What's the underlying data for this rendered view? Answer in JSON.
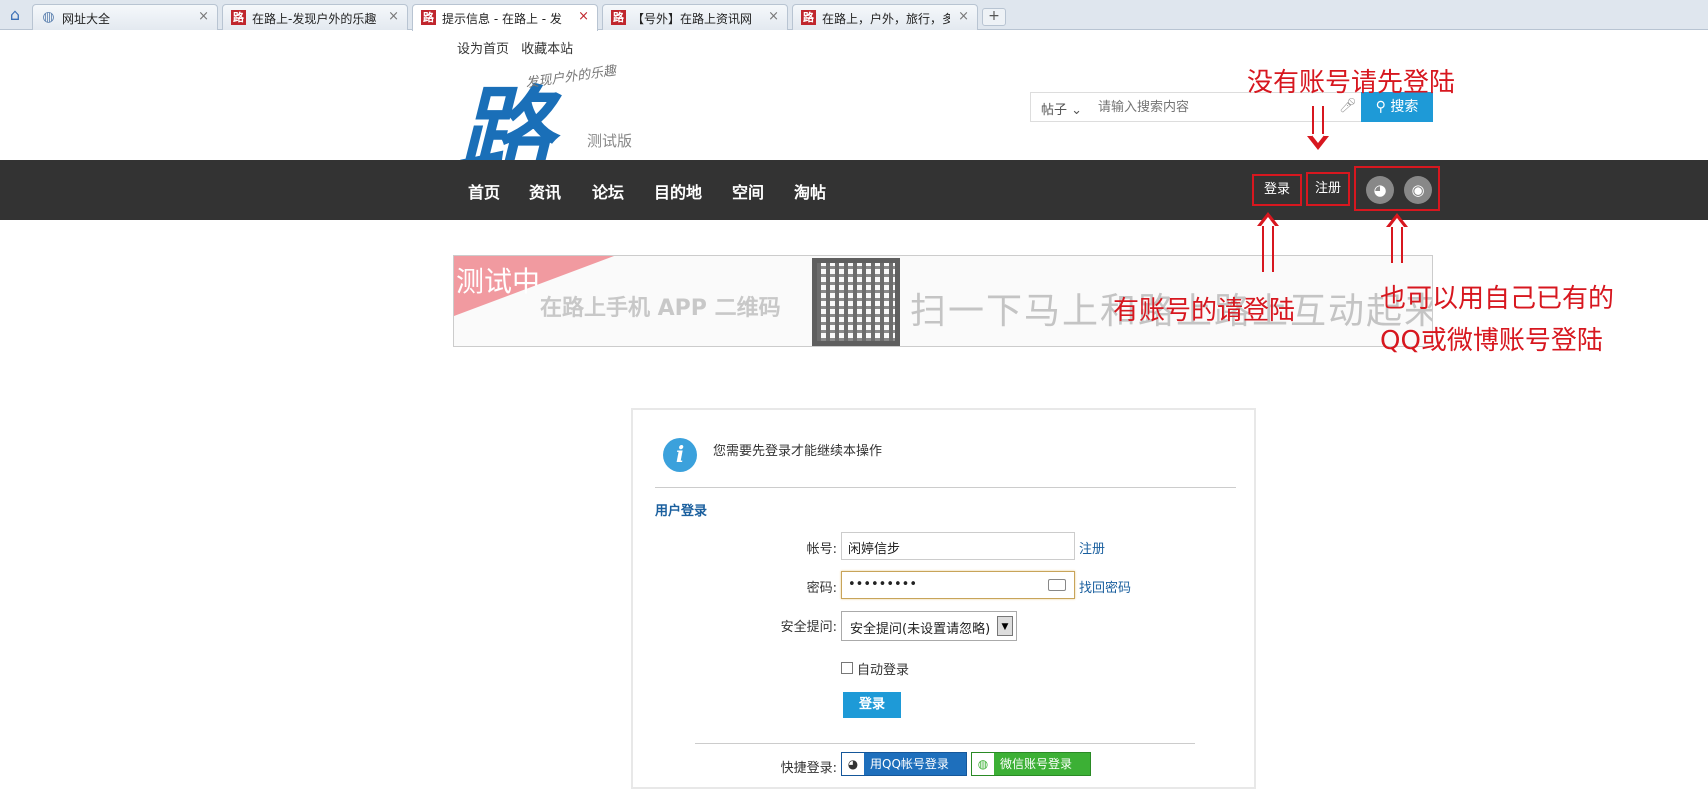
{
  "browser": {
    "tabs": [
      {
        "favicon": "globe-icon",
        "title": "网址大全",
        "active": false
      },
      {
        "favicon": "路",
        "title": "在路上-发现户外的乐趣",
        "active": false
      },
      {
        "favicon": "路",
        "title": "提示信息 - 在路上 - 发",
        "active": true
      },
      {
        "favicon": "路",
        "title": "【号外】在路上资讯网",
        "active": false
      },
      {
        "favicon": "路",
        "title": "在路上，户外，旅行，多",
        "active": false
      }
    ],
    "close_glyph": "×",
    "new_tab_glyph": "+"
  },
  "site": {
    "top_links": [
      "设为首页",
      "收藏本站"
    ],
    "logo_glyph": "路",
    "logo_slogan": "发现户外的乐趣",
    "beta_label": "测试版",
    "search": {
      "type": "帖子",
      "placeholder": "请输入搜索内容",
      "button": "搜索"
    },
    "nav": [
      "首页",
      "资讯",
      "论坛",
      "目的地",
      "空间",
      "淘帖"
    ],
    "login": "登录",
    "register": "注册"
  },
  "banner": {
    "badge": "测试中",
    "app_text": "在路上手机 APP 二维码",
    "scan_text": "扫一下马上和路上路上互动起来"
  },
  "annotations": {
    "register_hint": "没有账号请先登陆",
    "login_hint": "有账号的请登陆",
    "social_hint_1": "也可以用自己已有的",
    "social_hint_2": "QQ或微博账号登陆"
  },
  "login_form": {
    "notice": "您需要先登录才能继续本操作",
    "section_title": "用户登录",
    "username_label": "帐号:",
    "username_value": "闲婷信步",
    "register_link": "注册",
    "password_label": "密码:",
    "password_value": "•••••••••",
    "recover_link": "找回密码",
    "question_label": "安全提问:",
    "question_value": "安全提问(未设置请忽略)",
    "auto_login": "自动登录",
    "submit": "登录",
    "quick_label": "快捷登录:",
    "qq_button": "用QQ帐号登录",
    "wechat_button": "微信账号登录"
  },
  "colors": {
    "nav_bg": "#333333",
    "accent": "#1e9ad7",
    "annotation": "#d7171f"
  }
}
